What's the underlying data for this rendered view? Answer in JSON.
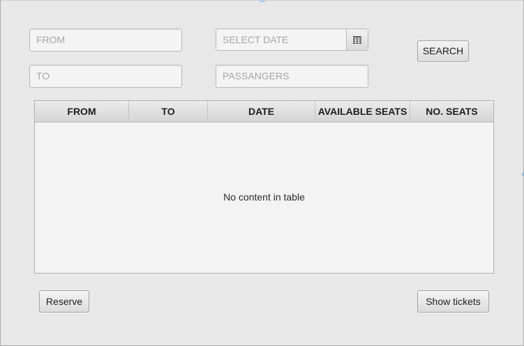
{
  "search": {
    "from_placeholder": "FROM",
    "to_placeholder": "TO",
    "date_placeholder": "SELECT DATE",
    "passengers_placeholder": "PASSANGERS",
    "search_label": "SEARCH",
    "calendar_icon": "calendar-icon"
  },
  "table": {
    "columns": [
      "FROM",
      "TO",
      "DATE",
      "AVAILABLE SEATS",
      "NO. SEATS"
    ],
    "empty_message": "No content in table"
  },
  "actions": {
    "reserve_label": "Reserve",
    "show_tickets_label": "Show tickets"
  }
}
